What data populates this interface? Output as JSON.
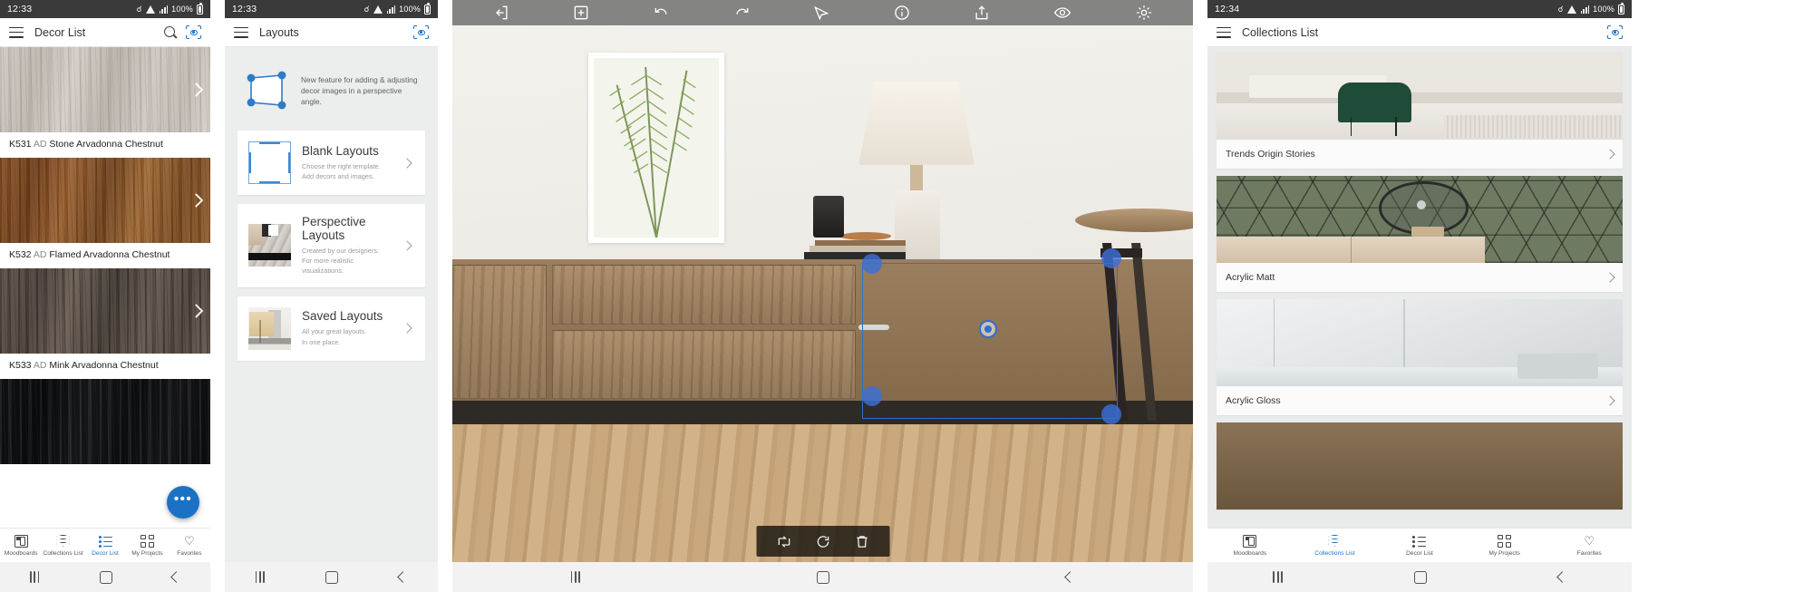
{
  "screens": [
    {
      "id": "decor-list",
      "status": {
        "time": "12:33",
        "battery": "100%",
        "icons": [
          "vpn-key-icon",
          "wifi-icon",
          "signal-icon",
          "battery-icon"
        ]
      },
      "appbar": {
        "title": "Decor List",
        "menu_icon": "hamburger-menu-icon",
        "search_icon": "search-icon",
        "scan_icon": "scan-visualizer-icon"
      },
      "items": [
        {
          "code": "K531",
          "grade": "AD",
          "name": "Stone Arvadonna Chestnut",
          "swatch": "w-stone"
        },
        {
          "code": "K532",
          "grade": "AD",
          "name": "Flamed Arvadonna Chestnut",
          "swatch": "w-flamed"
        },
        {
          "code": "K533",
          "grade": "AD",
          "name": "Mink Arvadonna Chestnut",
          "swatch": "w-mink"
        },
        {
          "code": "",
          "grade": "",
          "name": "",
          "swatch": "w-black"
        }
      ],
      "fab_label": "•••",
      "tabs": [
        {
          "label": "Moodboards",
          "icon": "moodboards-icon",
          "active": false
        },
        {
          "label": "Collections List",
          "icon": "collections-stack-icon",
          "active": false
        },
        {
          "label": "Decor List",
          "icon": "decor-list-icon",
          "active": true
        },
        {
          "label": "My Projects",
          "icon": "grid-projects-icon",
          "active": false
        },
        {
          "label": "Favorites",
          "icon": "heart-icon",
          "active": false
        }
      ]
    },
    {
      "id": "layouts",
      "status": {
        "time": "12:33",
        "battery": "100%"
      },
      "appbar": {
        "title": "Layouts",
        "menu_icon": "hamburger-menu-icon",
        "scan_icon": "scan-visualizer-icon"
      },
      "promo": {
        "icon": "perspective-quad-icon",
        "text": "New feature for adding & adjusting decor images in a perspective angle."
      },
      "cards": [
        {
          "title": "Blank Layouts",
          "sub1": "Choose the right template.",
          "sub2": "Add decors and images.",
          "thumb": "blank-layout-thumb"
        },
        {
          "title": "Perspective Layouts",
          "sub1": "Created by our designers.",
          "sub2": "For more realistic visualizations.",
          "thumb": "perspective-layout-thumb"
        },
        {
          "title": "Saved Layouts",
          "sub1": "All your great layouts.",
          "sub2": "In one place.",
          "thumb": "saved-layout-thumb"
        }
      ]
    },
    {
      "id": "editor",
      "toolbar": [
        {
          "icon": "exit-left-icon",
          "name": "exit-button"
        },
        {
          "icon": "add-image-icon",
          "name": "add-image-button"
        },
        {
          "icon": "undo-icon",
          "name": "undo-button"
        },
        {
          "icon": "redo-icon",
          "name": "redo-button"
        },
        {
          "icon": "perspective-tool-icon",
          "name": "perspective-button"
        },
        {
          "icon": "info-icon",
          "name": "info-button"
        },
        {
          "icon": "share-icon",
          "name": "share-button"
        },
        {
          "icon": "preview-eye-icon",
          "name": "preview-button"
        },
        {
          "icon": "settings-gear-icon",
          "name": "settings-button"
        }
      ],
      "float_actions": [
        {
          "icon": "flip-icon",
          "name": "flip-button"
        },
        {
          "icon": "rotate-icon",
          "name": "rotate-button"
        },
        {
          "icon": "delete-trash-icon",
          "name": "delete-button"
        }
      ]
    },
    {
      "id": "collections-list",
      "status": {
        "time": "12:34",
        "battery": "100%"
      },
      "appbar": {
        "title": "Collections List",
        "menu_icon": "hamburger-menu-icon",
        "scan_icon": "scan-visualizer-icon"
      },
      "collections": [
        {
          "name": "Trends Origin Stories",
          "image": "img-trends"
        },
        {
          "name": "Acrylic Matt",
          "image": "img-acrylic-matt"
        },
        {
          "name": "Acrylic Gloss",
          "image": "img-acrylic-gloss"
        }
      ],
      "tabs": [
        {
          "label": "Moodboards",
          "icon": "moodboards-icon",
          "active": false
        },
        {
          "label": "Collections List",
          "icon": "collections-stack-icon",
          "active": true
        },
        {
          "label": "Decor List",
          "icon": "decor-list-icon",
          "active": false
        },
        {
          "label": "My Projects",
          "icon": "grid-projects-icon",
          "active": false
        },
        {
          "label": "Favorites",
          "icon": "heart-icon",
          "active": false
        }
      ]
    }
  ],
  "android_nav": {
    "recent": "recent-apps-icon",
    "home": "home-icon",
    "back": "back-icon"
  },
  "colors": {
    "accent": "#1b72c4",
    "selection": "#2f6fd0",
    "statusbar": "#3a3a3a",
    "toolbar": "#848483"
  }
}
